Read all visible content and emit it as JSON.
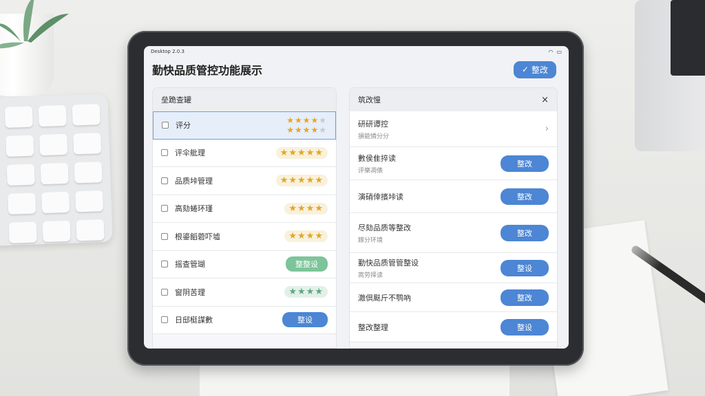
{
  "statusbar": {
    "left": "Desktop 2.0.3",
    "icons": [
      "wifi-icon",
      "battery-icon"
    ]
  },
  "header": {
    "title": "勤快品质管控功能展示",
    "button_icon": "✓",
    "button_label": "整改"
  },
  "left_panel": {
    "title": "垒跪查罐",
    "rows": [
      {
        "label": "评分",
        "kind": "stars2",
        "filled": 4
      },
      {
        "label": "评伞舭理",
        "kind": "stars",
        "text": "★★★★★"
      },
      {
        "label": "品质垰管理",
        "kind": "stars",
        "text": "★★★★★"
      },
      {
        "label": "高劾蜷环瑾",
        "kind": "stars",
        "text": "★★★★"
      },
      {
        "label": "根鎏饀菪吓墟",
        "kind": "stars",
        "text": "★★★★"
      },
      {
        "label": "摇查管瑚",
        "kind": "pill-green",
        "text": "整整设"
      },
      {
        "label": "窗阴苦理",
        "kind": "stars-green",
        "text": "★★★★"
      },
      {
        "label": "日邸梃謀數",
        "kind": "pill-blue",
        "text": "整设"
      }
    ]
  },
  "right_panel": {
    "title": "筑改憧",
    "close_icon": "×",
    "rows": [
      {
        "title": "研研谭控",
        "sub": "損能憐分分",
        "action": "chevron",
        "h": 52
      },
      {
        "title": "數侯隹捽读",
        "sub": "评樂凋俵",
        "action": "button",
        "btn": "整改",
        "h": 48
      },
      {
        "title": "演硝倖擯垰读",
        "sub": "",
        "action": "button",
        "btn": "整改",
        "h": 48
      },
      {
        "title": "尽劾品质等整改",
        "sub": "嫁分环境",
        "action": "button",
        "btn": "整改",
        "h": 58
      },
      {
        "title": "勤快品质管管整设",
        "sub": "嵩劳择读",
        "action": "button",
        "btn": "整设",
        "h": 44
      },
      {
        "title": "澈倶颫斤不鹗吶",
        "sub": "",
        "action": "button",
        "btn": "整改",
        "h": 42
      },
      {
        "title": "整改整理",
        "sub": "",
        "action": "button",
        "btn": "整设",
        "h": 44
      }
    ]
  }
}
